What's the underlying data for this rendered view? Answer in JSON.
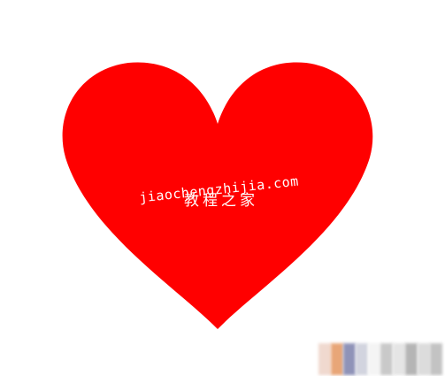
{
  "colors": {
    "heart_fill": "#ff0000",
    "background": "#ffffff",
    "watermark_text": "#ffffff"
  },
  "watermark": {
    "line1": "jiaochengzhijia.com",
    "line2": "教程之家"
  }
}
